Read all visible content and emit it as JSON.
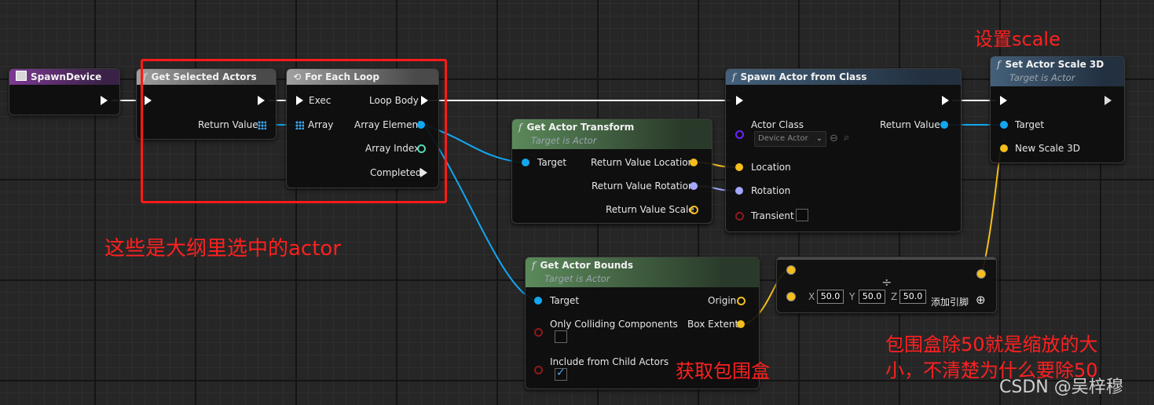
{
  "nodes": {
    "spawn_device": {
      "title": "SpawnDevice"
    },
    "get_selected_actors": {
      "title": "Get Selected Actors",
      "return_value": "Return Value"
    },
    "for_each_loop": {
      "title": "For Each Loop",
      "exec": "Exec",
      "array": "Array",
      "loop_body": "Loop Body",
      "array_element": "Array Element",
      "array_index": "Array Index",
      "completed": "Completed"
    },
    "get_actor_transform": {
      "title": "Get Actor Transform",
      "subtitle": "Target is Actor",
      "target": "Target",
      "ret_location": "Return Value Location",
      "ret_rotation": "Return Value Rotation",
      "ret_scale": "Return Value Scale"
    },
    "spawn_actor": {
      "title": "Spawn Actor from Class",
      "actor_class": "Actor Class",
      "class_value": "Device Actor",
      "return_value": "Return Value",
      "location": "Location",
      "rotation": "Rotation",
      "transient": "Transient"
    },
    "set_actor_scale": {
      "title": "Set Actor Scale 3D",
      "subtitle": "Target is Actor",
      "target": "Target",
      "new_scale": "New Scale 3D"
    },
    "get_actor_bounds": {
      "title": "Get Actor Bounds",
      "subtitle": "Target is Actor",
      "target": "Target",
      "origin": "Origin",
      "only_colliding": "Only Colliding Components",
      "box_extent": "Box Extent",
      "include_child": "Include from Child Actors"
    },
    "divide": {
      "x_label": "X",
      "x_value": "50.0",
      "y_label": "Y",
      "y_value": "50.0",
      "z_label": "Z",
      "z_value": "50.0",
      "add_pin": "添加引脚",
      "op": "÷"
    }
  },
  "annotations": {
    "set_scale": "设置scale",
    "selected_actors": "这些是大纲里选中的actor",
    "get_bounds": "获取包围盒",
    "divide_note_line1": "包围盒除50就是缩放的大",
    "divide_note_line2": "小，不清楚为什么要除50"
  },
  "watermark": "CSDN @吴梓穆",
  "colors": {
    "exec_wire": "#ffffff",
    "object_wire": "#12a7ef",
    "vector_wire": "#f4be1b",
    "rotator_wire": "#a3a7ff",
    "annotation_red": "#ff2020",
    "highlight_box": "#ff1a1a"
  }
}
